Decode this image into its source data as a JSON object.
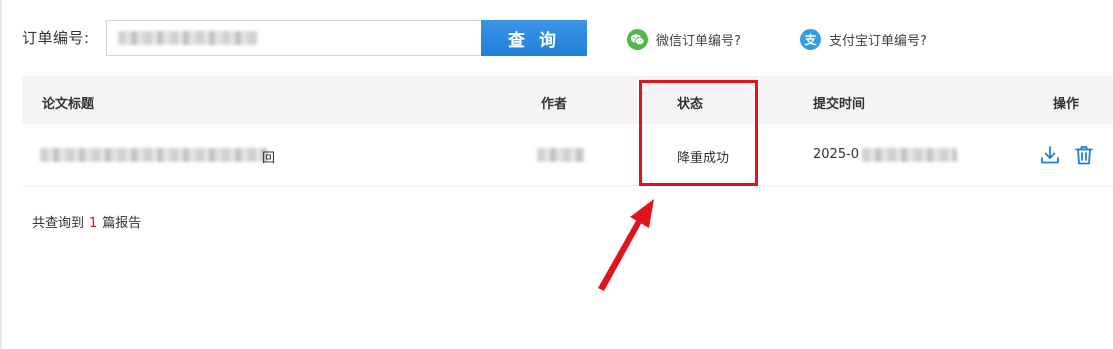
{
  "search": {
    "label": "订单编号:",
    "value": "",
    "button_label": "查 询"
  },
  "help_links": {
    "wechat": "微信订单编号?",
    "alipay": "支付宝订单编号?",
    "alipay_icon_glyph": "支"
  },
  "table": {
    "headers": {
      "title": "论文标题",
      "author": "作者",
      "status": "状态",
      "submit_time": "提交时间",
      "actions": "操作"
    },
    "rows": [
      {
        "title_visible_suffix": "回",
        "author": "",
        "status": "降重成功",
        "submit_time_prefix": "2025-0"
      }
    ]
  },
  "summary": {
    "prefix": "共查询到",
    "count": "1",
    "suffix": "篇报告"
  },
  "icons": {
    "wechat": "wechat-icon",
    "alipay": "alipay-icon",
    "download": "download-icon",
    "delete": "trash-icon",
    "annotation_arrow": "arrow-icon"
  },
  "colors": {
    "accent": "#1f7fd8",
    "highlight": "#e0151b",
    "wechat": "#4fb848",
    "alipay": "#2f9ee4"
  }
}
